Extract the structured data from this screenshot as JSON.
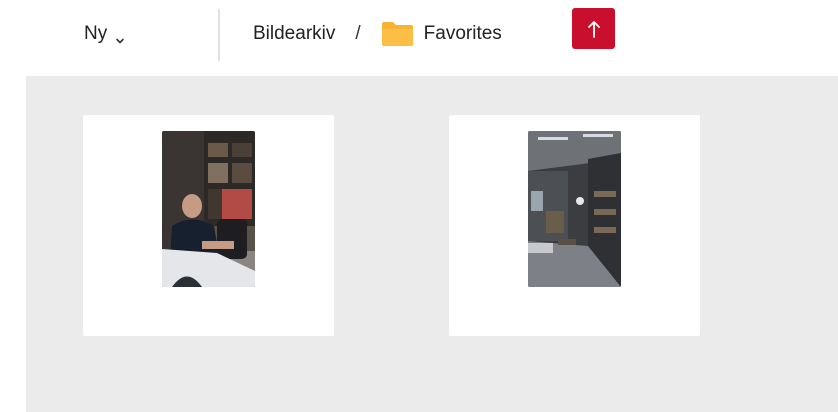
{
  "toolbar": {
    "new_menu": {
      "label": "Ny",
      "icon": "chevron-down-icon"
    },
    "breadcrumb": {
      "root": "Bildearkiv",
      "separator": "/",
      "current": {
        "label": "Favorites",
        "icon": "folder-icon",
        "icon_color": "#f9b233"
      }
    },
    "upload_button": {
      "icon": "arrow-up-icon",
      "color": "#c8102e"
    }
  },
  "content": {
    "background": "#ebebeb",
    "items": [
      {
        "type": "image",
        "thumbnail": "man-at-desk-photo"
      },
      {
        "type": "image",
        "thumbnail": "office-interior-photo"
      }
    ]
  }
}
